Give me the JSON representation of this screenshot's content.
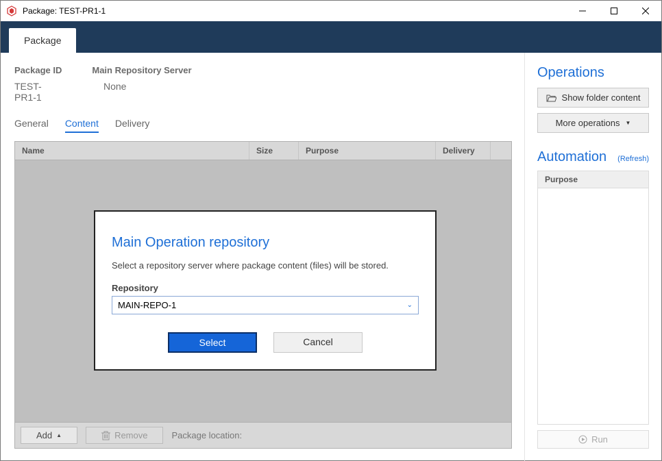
{
  "window": {
    "title": "Package: TEST-PR1-1"
  },
  "headerTab": "Package",
  "info": {
    "packageIdLabel": "Package ID",
    "packageIdValue": "TEST-PR1-1",
    "repoLabel": "Main Repository Server",
    "repoValue": "None"
  },
  "tabs": {
    "general": "General",
    "content": "Content",
    "delivery": "Delivery"
  },
  "table": {
    "columns": {
      "name": "Name",
      "size": "Size",
      "purpose": "Purpose",
      "delivery": "Delivery"
    }
  },
  "toolbar": {
    "add": "Add",
    "remove": "Remove",
    "packageLocation": "Package location:"
  },
  "right": {
    "operationsTitle": "Operations",
    "showFolder": "Show folder content",
    "moreOps": "More operations",
    "automationTitle": "Automation",
    "refresh": "(Refresh)",
    "purpose": "Purpose",
    "run": "Run"
  },
  "dialog": {
    "title": "Main Operation repository",
    "desc": "Select a repository server where package content (files) will be stored.",
    "fieldLabel": "Repository",
    "selected": "MAIN-REPO-1",
    "select": "Select",
    "cancel": "Cancel"
  }
}
